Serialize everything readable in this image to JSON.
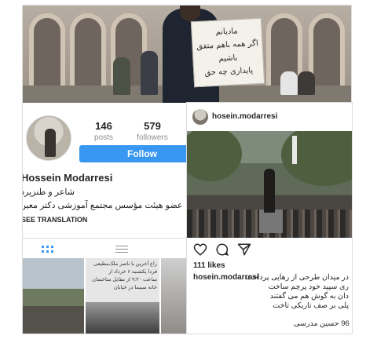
{
  "profile": {
    "posts_count": "146",
    "posts_label": "posts",
    "followers_count": "579",
    "followers_label": "followers",
    "follow_button": "Follow",
    "name": "Hossein Modarresi",
    "bio_line1": "شاعر و طنزپرداز",
    "bio_line2": "عضو هیئت مؤسس مجتمع آموزشی دکتر معین",
    "see_translation": "SEE TRANSLATION",
    "placard_lines": [
      "مادیانم",
      "اگر همه باهم متفق",
      "باشیم",
      "پایداری چه حق"
    ],
    "thumbnail_text": [
      "راع آخرین با ناصر ملک‌مطیعی",
      "فردا یکشنبه ۶ خرداد از",
      "ساعت ۹:۳۰ از مقابل ساختمان",
      "خانه سینما در خیابان"
    ]
  },
  "post": {
    "username": "hosein.modarresi",
    "likes": "111 likes",
    "caption_user": "hosein.modarresi",
    "caption_lines": [
      "در میدان طرحی از رهایی پرداخت",
      "ری سپید خود پرچم ساخت",
      "دان به گوش هم می گفتند",
      "پلی بر صف تاریکی تاخت"
    ],
    "caption_last": "96 حسین مدرسی"
  },
  "icons": [
    "grid-icon",
    "list-icon",
    "heart-icon",
    "comment-icon",
    "share-icon"
  ],
  "colors": {
    "follow_blue": "#3897f0",
    "text": "#262626",
    "muted": "#8e8e8e"
  }
}
